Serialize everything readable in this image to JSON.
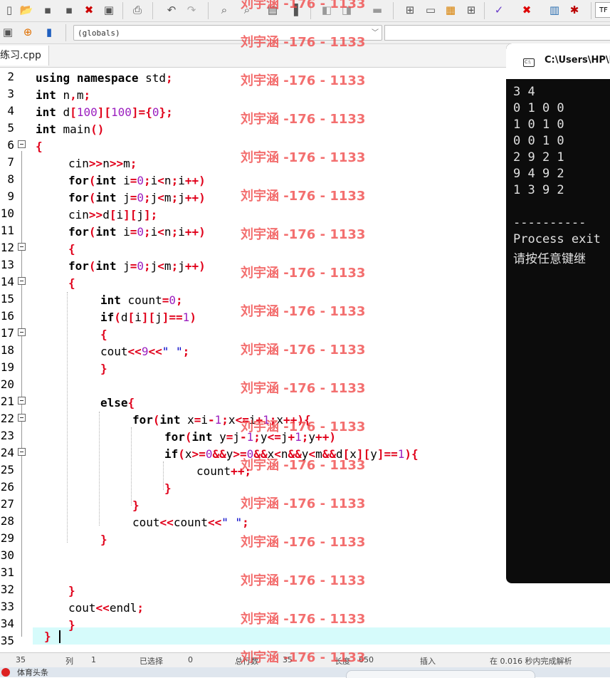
{
  "toolbar": {
    "icons": [
      "new-file",
      "open-file",
      "save",
      "save-all",
      "close",
      "print-preview",
      "print",
      "undo",
      "redo",
      "find",
      "replace",
      "goto",
      "bookmark",
      "indent",
      "unindent",
      "toggle-comment",
      "grid-view",
      "window",
      "palette",
      "grid-small",
      "check",
      "compile-error",
      "chart",
      "debug-stop"
    ],
    "truncated_label": "TF"
  },
  "scope_bar": {
    "scope_value": "(globals)"
  },
  "tabs": [
    {
      "label": "练习.cpp"
    }
  ],
  "editor": {
    "line_numbers": [
      "2",
      "3",
      "4",
      "5",
      "6",
      "7",
      "8",
      "9",
      "10",
      "11",
      "12",
      "13",
      "14",
      "15",
      "16",
      "17",
      "18",
      "19",
      "20",
      "21",
      "22",
      "23",
      "24",
      "25",
      "26",
      "27",
      "28",
      "29",
      "30",
      "31",
      "32",
      "33",
      "34",
      "35"
    ],
    "code": {
      "l2": "using namespace std;",
      "l3": "int n,m;",
      "l4": "int d[100][100]={0};",
      "l5": "int main()",
      "l6": "{",
      "l7": "cin>>n>>m;",
      "l8": "for(int i=0;i<n;i++)",
      "l9": "for(int j=0;j<m;j++)",
      "l10": "cin>>d[i][j];",
      "l11": "for(int i=0;i<n;i++)",
      "l12": "{",
      "l13": "for(int j=0;j<m;j++)",
      "l14": "{",
      "l15": "int count=0;",
      "l16": "if(d[i][j]==1)",
      "l17": "{",
      "l18": "cout<<9<<\" \";",
      "l19": "}",
      "l21": "else{",
      "l22": "for(int x=i-1;x<=i+1;x++){",
      "l23": "for(int y=j-1;y<=j+1;y++)",
      "l24": "if(x>=0&&y>=0&&x<n&&y<m&&d[x][y]==1){",
      "l25": "count++;",
      "l26": "}",
      "l27": "}",
      "l28": "cout<<count<<\" \";",
      "l29": "}",
      "l32": "}",
      "l33": "cout<<endl;",
      "l34": "}",
      "l35": "}"
    }
  },
  "console": {
    "title": "C:\\Users\\HP\\D",
    "icon_text": "C:\\",
    "lines": [
      "3 4",
      "0 1 0 0",
      "1 0 1 0",
      "0 0 1 0",
      "2 9 2 1",
      "9 4 9 2",
      "1 3 9 2",
      "",
      "----------",
      "Process exit",
      "请按任意键继"
    ]
  },
  "status_bar": {
    "items": [
      "35",
      "列",
      "1",
      "已选择",
      "0",
      "总行数",
      "35",
      "长度",
      "650",
      "插入",
      "在 0.016 秒内完成解析"
    ]
  },
  "taskbar": {
    "label": "体育头条"
  },
  "watermark": {
    "text": "刘宇涵 -176 - 1133"
  },
  "colors": {
    "keyword": "#000000",
    "operator": "#e0001a",
    "number": "#9b1fbf",
    "string": "#0000c8",
    "current_line": "#d6fbfb",
    "console_bg": "#0c0c0c"
  }
}
